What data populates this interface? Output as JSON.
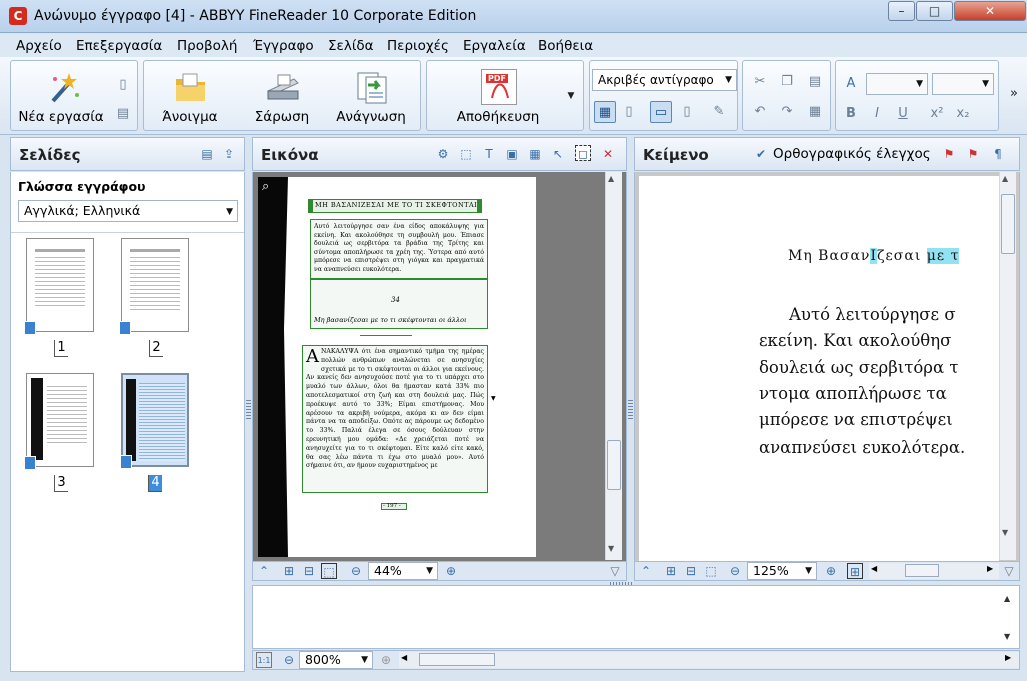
{
  "window": {
    "title": "Ανώνυμο έγγραφο [4] - ABBYY FineReader 10 Corporate Edition",
    "app_icon_letter": "C"
  },
  "window_controls": {
    "minimize": "–",
    "maximize": "□",
    "close": "✕"
  },
  "menu": [
    "Αρχείο",
    "Επεξεργασία",
    "Προβολή",
    "Έγγραφο",
    "Σελίδα",
    "Περιοχές",
    "Εργαλεία",
    "Βοήθεια"
  ],
  "toolbar": {
    "new_task": "Νέα εργασία",
    "open": "Άνοιγμα",
    "scan": "Σάρωση",
    "read": "Ανάγνωση",
    "save": "Αποθήκευση",
    "save_format_icon": "PDF",
    "format_mode": "Ακριβές αντίγραφο",
    "font_name": "",
    "font_size": "",
    "more": "»"
  },
  "pages_panel": {
    "title": "Σελίδες",
    "language_label": "Γλώσσα εγγράφου",
    "language_value": "Αγγλικά; Ελληνικά",
    "thumbnails": [
      {
        "num": "1"
      },
      {
        "num": "2"
      },
      {
        "num": "3"
      },
      {
        "num": "4"
      }
    ],
    "selected_page": "4"
  },
  "image_panel": {
    "title": "Εικόνα",
    "zoom": "44%",
    "page": {
      "header": "Μη Βασανιζεσαι με το τι Σκεφτονται οι Αλλοι",
      "para1": "Αυτό λειτούργησε σαν ένα είδος αποκάλυψης για εκείνη. Και ακολούθησε τη συμβουλή μου. Έπιασε δουλειά ως σερβιτόρα τα βράδια της Τρίτης και σύντομα αποπλήρωσε τα χρέη της. Ύστερα από αυτό μπόρεσε να επιστρέψει στη γιόγκα και πραγματικά να αναπνεύσει ευκολότερα.",
      "page_number_top": "34",
      "caption_top": "Μη βασανίζεσαι με το τι σκέφτονται οι άλλοι",
      "drop_cap": "Α",
      "para2": "ΝΑΚΑΛΥΨΑ ότι ένα σημαντικό τμήμα της ημέρας πολλών ανθρώπων αναλώνεται σε ανησυχίες σχετικά με το τι σκέφτονται οι άλλοι για εκείνους. Αν κανείς δεν ανησυχούσε ποτέ για το τι υπάρχει στο μυαλό των άλλων, όλοι θα ήμασταν κατά 33% πιο αποτελεσματικοί στη ζωή και στη δουλειά μας. Πώς προέκυψε αυτό το 33%; Είμαι επιστήμονας. Μου αρέσουν τα ακριβή νούμερα, ακόμα κι αν δεν είμαι πάντα να τα αποδείξω. Οπότε ας πάρουμε ως δεδομένο το 33%. Παλιά έλεγα σε όσους δούλευαν στην ερευνητική μου ομάδα: «Δε χρειάζεται ποτέ να ανησυχείτε για το τι σκέφτομαι. Είτε καλό είτε κακό, θα σας λέω πάντα τι έχω στο μυαλό μου». Αυτό σήμαινε ότι, αν ήμουν ευχαριστημένος με",
      "page_number_bottom": "- 197 -"
    }
  },
  "text_panel": {
    "title": "Κείμενο",
    "spellcheck": "Ορθογραφικός έλεγχος",
    "zoom": "125%",
    "heading_pre": "Μη Βασαν",
    "heading_hl1": "Ι",
    "heading_mid": "ζεσαι ",
    "heading_hl2": "με τ",
    "lines": [
      "Αυτό λειτούργησε σ",
      "εκείνη. Και ακολούθησ",
      "δουλειά ως σερβιτόρα τ",
      "ντομα αποπλήρωσε τα",
      "μπόρεσε να επιστρέψει",
      "αναπνεύσει ευκολότερα."
    ]
  },
  "zoom_panel": {
    "zoom": "800%"
  },
  "colors": {
    "accent": "#3d8ddc",
    "region_green": "#2f8a2f",
    "highlight": "#93e2f2",
    "title_bg": "#c4d9f1"
  },
  "icons": {
    "new_task": "magic-wand-icon",
    "open": "folder-icon",
    "scan": "scanner-icon",
    "read": "read-document-icon",
    "save": "pdf-save-icon"
  }
}
